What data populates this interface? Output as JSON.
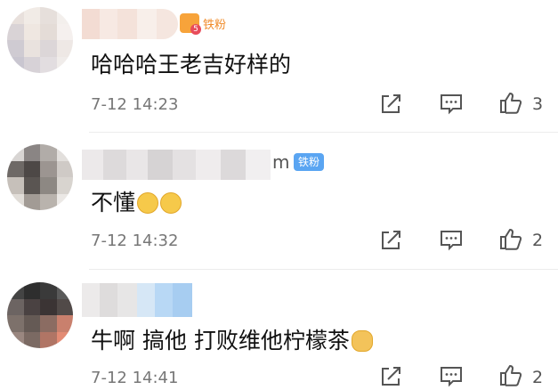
{
  "comments": [
    {
      "name_suffix": "",
      "fan_label": "铁粉",
      "crown_level": "5",
      "text": "哈哈哈王老吉好样的",
      "time": "7-12 14:23",
      "likes": "3"
    },
    {
      "name_suffix": "m",
      "fan_label": "铁粉",
      "text": "不懂",
      "emojis": [
        "astonished-emoji",
        "astonished-emoji"
      ],
      "time": "7-12 14:32",
      "likes": "2"
    },
    {
      "text": "牛啊 搞他 打败维他柠檬茶",
      "emojis": [
        "doge-emoji"
      ],
      "time": "7-12 14:41",
      "likes": "2"
    }
  ],
  "icons": {
    "share": "share-icon",
    "reply": "comment-icon",
    "like": "thumbs-up-icon"
  },
  "colors": {
    "fan_badge": "#5aa5f2",
    "crown_label": "#f08c2b",
    "time_text": "#777777"
  }
}
